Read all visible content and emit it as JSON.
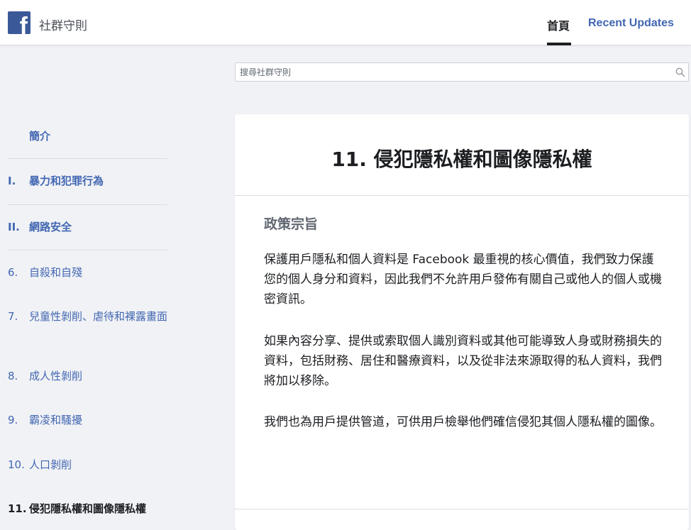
{
  "header": {
    "site_title": "社群守則",
    "nav_home": "首頁",
    "nav_recent": "Recent Updates"
  },
  "search": {
    "placeholder": "搜尋社群守則"
  },
  "sidebar": {
    "items": [
      {
        "num": "",
        "label": "簡介"
      },
      {
        "num": "I.",
        "label": "暴力和犯罪行為"
      },
      {
        "num": "II.",
        "label": "網路安全"
      },
      {
        "num": "6.",
        "label": "自殺和自殘"
      },
      {
        "num": "7.",
        "label": "兒童性剝削、虐待和裸露畫面"
      },
      {
        "num": "8.",
        "label": "成人性剝削"
      },
      {
        "num": "9.",
        "label": "霸凌和騷擾"
      },
      {
        "num": "10.",
        "label": "人口剝削"
      },
      {
        "num": "11.",
        "label": "侵犯隱私權和圖像隱私權"
      }
    ]
  },
  "main": {
    "title": "11. 侵犯隱私權和圖像隱私權",
    "section_heading": "政策宗旨",
    "paragraphs": [
      "保護用戶隱私和個人資料是 Facebook 最重視的核心價值，我們致力保護您的個人身分和資料，因此我們不允許用戶發佈有關自己或他人的個人或機密資訊。",
      "如果內容分享、提供或索取個人識別資料或其他可能導致人身或財務損失的資料，包括財務、居住和醫療資料，以及從非法來源取得的私人資料，我們將加以移除。",
      "我們也為用戶提供管道，可供用戶檢舉他們確信侵犯其個人隱私權的圖像。"
    ]
  },
  "colors": {
    "brand": "#3b5998",
    "link": "#4267b2",
    "background": "#f1f2f5"
  },
  "icons": {
    "logo": "facebook-f-logo",
    "search": "search-icon"
  }
}
